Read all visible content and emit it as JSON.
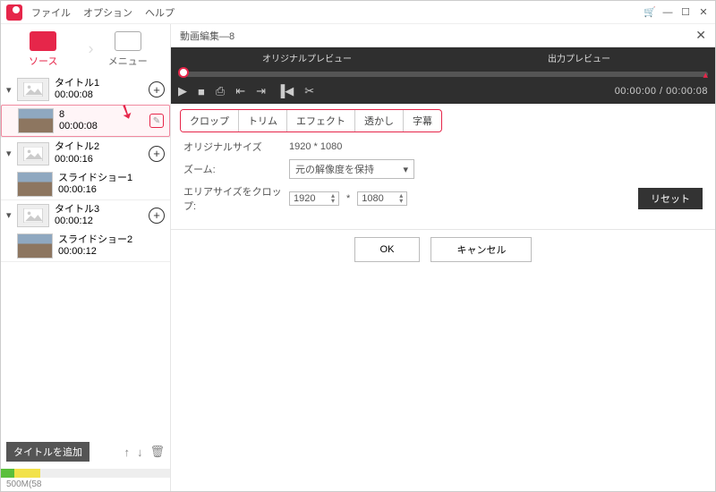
{
  "menubar": {
    "file": "ファイル",
    "option": "オプション",
    "help": "ヘルプ"
  },
  "tabs": {
    "source": "ソース",
    "menu": "メニュー"
  },
  "groups": [
    {
      "title": "タイトル1",
      "duration": "00:00:08",
      "clips": [
        {
          "name": "8",
          "duration": "00:00:08",
          "selected": true
        }
      ]
    },
    {
      "title": "タイトル2",
      "duration": "00:00:16",
      "clips": [
        {
          "name": "スライドショー1",
          "duration": "00:00:16"
        }
      ]
    },
    {
      "title": "タイトル3",
      "duration": "00:00:12",
      "clips": [
        {
          "name": "スライドショー2",
          "duration": "00:00:12"
        }
      ]
    }
  ],
  "leftfoot": {
    "addTitle": "タイトルを追加",
    "capacity": "500M(58"
  },
  "editor": {
    "title": "動画編集—8",
    "previewLabels": {
      "original": "オリジナルプレビュー",
      "output": "出力プレビュー"
    },
    "time": "00:00:00 / 00:00:08",
    "tabs": [
      "クロップ",
      "トリム",
      "エフェクト",
      "透かし",
      "字幕"
    ],
    "crop": {
      "origLabel": "オリジナルサイズ",
      "origValue": "1920 * 1080",
      "zoomLabel": "ズーム:",
      "zoomValue": "元の解像度を保持",
      "areaLabel": "エリアサイズをクロップ:",
      "w": "1920",
      "h": "1080",
      "reset": "リセット"
    },
    "ok": "OK",
    "cancel": "キャンセル"
  }
}
